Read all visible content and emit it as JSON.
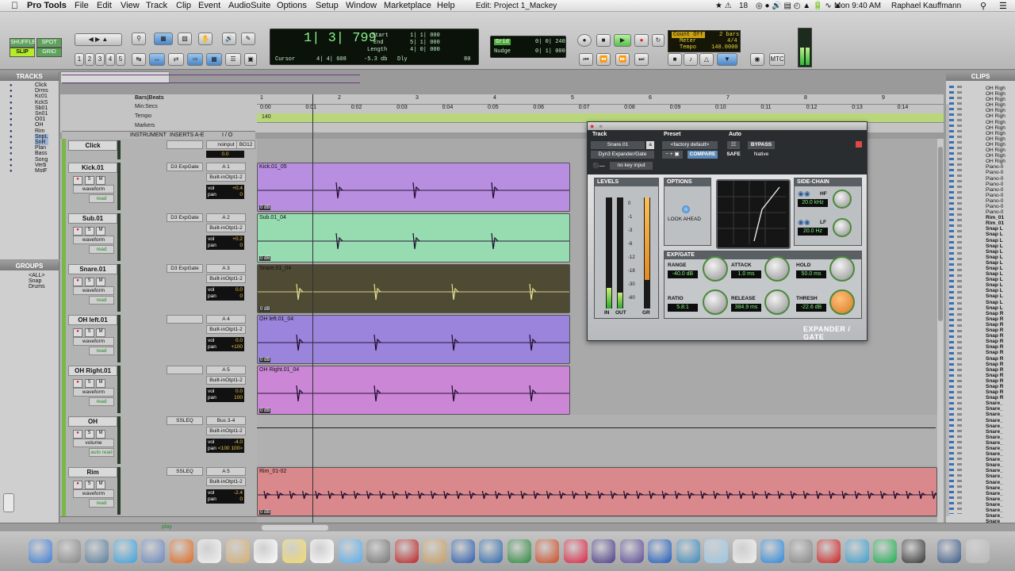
{
  "menubar": {
    "app": "Pro Tools",
    "items": [
      "File",
      "Edit",
      "View",
      "Track",
      "Clip",
      "Event",
      "AudioSuite",
      "Options",
      "Setup",
      "Window",
      "Marketplace",
      "Help"
    ],
    "window_title": "Edit: Project 1_Mackey",
    "calendar_count": "18",
    "clock": "Mon 9:40 AM",
    "user": "Raphael Kauffmann"
  },
  "toolbar": {
    "modes": [
      "SHUFFLE",
      "SPOT",
      "SLIP",
      "GRID"
    ],
    "zoom_presets": [
      "1",
      "2",
      "3",
      "4",
      "5"
    ],
    "main_counter": "1| 3| 799",
    "cursor_label": "Cursor",
    "cursor_value": "4| 4| 608",
    "cursor_level": "-5.3 db",
    "start_label": "Start",
    "end_label": "End",
    "length_label": "Length",
    "start": "1| 1| 000",
    "end": "5| 1| 000",
    "length": "4| 0| 000",
    "start2": "1| 1| 000",
    "end2": "1| 1| 000",
    "length2": "0| 0| 000",
    "dly_label": "Dly",
    "tempo_small": "80",
    "grid_label": "Grid",
    "grid_value": "0| 0| 240",
    "nudge_label": "Nudge",
    "nudge_value": "0| 1| 000",
    "count_off": "Count Off",
    "count_bars": "2 bars",
    "meter_label": "Meter",
    "meter_value": "4/4",
    "tempo_label": "Tempo",
    "tempo_value": "140.0000",
    "mtc": "MTC"
  },
  "panels": {
    "tracks_title": "TRACKS",
    "groups_title": "GROUPS",
    "clips_title": "CLIPS",
    "track_list": [
      "Click",
      "Drms",
      "Kc01",
      "KckS",
      "Sb01",
      "Sn01",
      "O01",
      "OH",
      "Rim",
      "SnpL",
      "SnR",
      "Plan",
      "Bass",
      "Song",
      "Verb",
      "MstF"
    ],
    "groups": [
      "<ALL>",
      "Snap",
      "Drums"
    ],
    "clip_list": [
      "OH Righ",
      "OH Righ",
      "OH Righ",
      "OH Righ",
      "OH Righ",
      "OH Righ",
      "OH Righ",
      "OH Righ",
      "OH Righ",
      "OH Righ",
      "OH Righ",
      "OH Righ",
      "OH Righ",
      "OH Righ",
      "Piano-0",
      "Piano-0",
      "Piano-0",
      "Piano-0",
      "Piano-0",
      "Piano-0",
      "Piano-0",
      "Piano-0",
      "Piano-0",
      "Rim_01",
      "Rim_01",
      "Snap L",
      "Snap L",
      "Snap L",
      "Snap L",
      "Snap L",
      "Snap L",
      "Snap L",
      "Snap L",
      "Snap L",
      "Snap L",
      "Snap L",
      "Snap L",
      "Snap L",
      "Snap L",
      "Snap L",
      "Snap R",
      "Snap R",
      "Snap R",
      "Snap R",
      "Snap R",
      "Snap R",
      "Snap R",
      "Snap R",
      "Snap R",
      "Snap R",
      "Snap R",
      "Snap R",
      "Snap R",
      "Snap R",
      "Snap R",
      "Snap R",
      "Snare_",
      "Snare_",
      "Snare_",
      "Snare_",
      "Snare_",
      "Snare_",
      "Snare_",
      "Snare_",
      "Snare_",
      "Snare_",
      "Snare_",
      "Snare_",
      "Snare_",
      "Snare_",
      "Snare_",
      "Snare_",
      "Snare_",
      "Snare_",
      "Snare_",
      "Snare_",
      "Snare_",
      "Snare_",
      "Snare_",
      "Snare_",
      "Snare_",
      "Snare_",
      "Snare_"
    ]
  },
  "rulers": {
    "labels": [
      "Bars|Beats",
      "Min:Secs",
      "Tempo",
      "Markers"
    ],
    "bars": [
      "1",
      "2",
      "3",
      "4",
      "5",
      "6",
      "7",
      "8",
      "9"
    ],
    "secs": [
      "0:00",
      "0:01",
      "0:02",
      "0:03",
      "0:04",
      "0:05",
      "0:06",
      "0:07",
      "0:08",
      "0:09",
      "0:10",
      "0:11",
      "0:12",
      "0:13",
      "0:14"
    ],
    "tempo_marker": "140"
  },
  "column_headers": {
    "instrument": "INSTRUMENT",
    "inserts": "INSERTS A-E",
    "io": "I / O"
  },
  "tracks": [
    {
      "name": "Click",
      "insert": "",
      "io1": "noinput",
      "io1b": "BO12",
      "io2": "",
      "vol": "0.0",
      "pan": "",
      "mode": "",
      "auto": ""
    },
    {
      "name": "Kick.01",
      "insert": "D3 ExpGate",
      "io1": "A 1",
      "io2": "Built-inOtpt1-2",
      "vol": "+0.4",
      "pan": "0",
      "mode": "waveform",
      "auto": "read"
    },
    {
      "name": "Sub.01",
      "insert": "D3 ExpGate",
      "io1": "A 2",
      "io2": "Built-inOtpt1-2",
      "vol": "+0.2",
      "pan": "0",
      "mode": "waveform",
      "auto": "read"
    },
    {
      "name": "Snare.01",
      "insert": "D3 ExpGate",
      "io1": "A 3",
      "io2": "Built-inOtpt1-2",
      "vol": "0.0",
      "pan": "0",
      "mode": "waveform",
      "auto": "read"
    },
    {
      "name": "OH left.01",
      "insert": "",
      "io1": "A 4",
      "io2": "Built-inOtpt1-2",
      "vol": "0.0",
      "pan": "+100",
      "mode": "waveform",
      "auto": "read"
    },
    {
      "name": "OH Right.01",
      "insert": "",
      "io1": "A 5",
      "io2": "Built-inOtpt1-2",
      "vol": "0.0",
      "pan": "100",
      "mode": "waveform",
      "auto": "read"
    },
    {
      "name": "OH",
      "insert": "SSLEQ",
      "io1": "Bus 3-4",
      "io2": "Built-inOtpt1-2",
      "vol": "-4.0",
      "pan": "<100  100>",
      "mode": "volume",
      "auto": "auto read"
    },
    {
      "name": "Rim",
      "insert": "SSLEQ",
      "io1": "A 5",
      "io2": "Built-inOtpt1-2",
      "vol": "-2.4",
      "pan": "0",
      "mode": "waveform",
      "auto": "read"
    }
  ],
  "clips": [
    {
      "name": "Kick.01_05",
      "db": "0 dB",
      "color": "#b88ee0"
    },
    {
      "name": "Sub.01_04",
      "db": "0 dB",
      "color": "#96dcb0"
    },
    {
      "name": "Snare.01_04",
      "db": "0 dB",
      "color": "#4e4a34"
    },
    {
      "name": "OH left.01_04",
      "db": "0 dB",
      "color": "#9a84dc"
    },
    {
      "name": "OH Right.01_04",
      "db": "0 dB",
      "color": "#cb86d6"
    },
    {
      "name": "",
      "db": "",
      "color": ""
    },
    {
      "name": "Rim_01-02",
      "db": "0 dB",
      "color": "#d9898c"
    }
  ],
  "plugin": {
    "track_label": "Track",
    "preset_label": "Preset",
    "auto_label": "Auto",
    "track_name": "Snare.01",
    "track_letter": "a",
    "plugin_name": "Dyn3 Expander/Gate",
    "preset_name": "<factory default>",
    "compare": "COMPARE",
    "bypass": "BYPASS",
    "safe": "SAFE",
    "native": "Native",
    "key_input": "no key input",
    "levels": "LEVELS",
    "options": "OPTIONS",
    "look_ahead": "LOOK AHEAD",
    "sidechain": "SIDE-CHAIN",
    "hf_label": "HF",
    "hf": "20.0 kHz",
    "lf_label": "LF",
    "lf": "20.0 Hz",
    "expgate": "EXP/GATE",
    "range_label": "RANGE",
    "range": "-40.0 dB",
    "attack_label": "ATTACK",
    "attack": "1.0 ms",
    "hold_label": "HOLD",
    "hold": "50.0 ms",
    "ratio_label": "RATIO",
    "ratio": "5.8:1",
    "release_label": "RELEASE",
    "release": "384.9 ms",
    "thresh_label": "THRESH",
    "thresh": "-22.6 dB",
    "meter_in": "IN",
    "meter_out": "OUT",
    "meter_gr": "GR",
    "scale": [
      "0",
      "-1",
      "-3",
      "-6",
      "-12",
      "-18",
      "-30",
      "-60"
    ],
    "logo": "EXPANDER / GATE"
  },
  "bottom": {
    "play": "play"
  }
}
